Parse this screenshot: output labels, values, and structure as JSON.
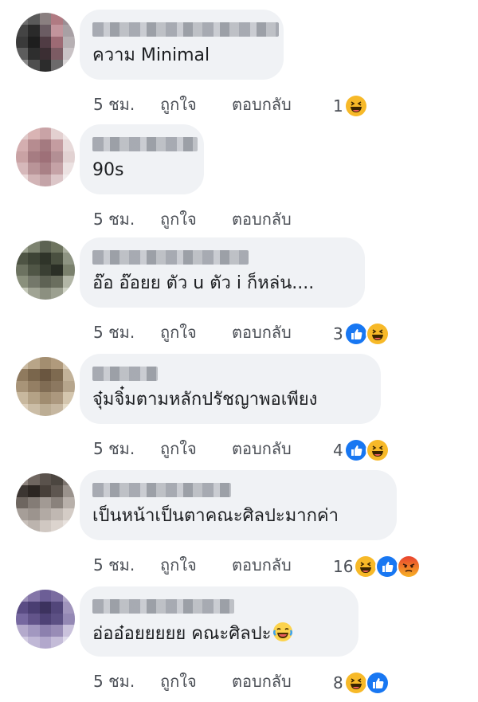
{
  "comments": [
    {
      "text": "ความ Minimal",
      "time": "5 ชม.",
      "like": "ถูกใจ",
      "reply": "ตอบกลับ",
      "reaction_count": "1",
      "reactions": [
        "haha-icon"
      ],
      "avatar_colors": [
        "#6f6f6f",
        "#5a5a5a",
        "#8a7f80",
        "#b07a82",
        "#9b8e94",
        "#444",
        "#2a2a2a",
        "#6b5c63",
        "#c2949c",
        "#a8a0a4",
        "#3a3a3a",
        "#1e1e1e",
        "#503c44",
        "#9d6a74",
        "#b7b0b3",
        "#5d5d5d",
        "#2e2e2e",
        "#3b2e33",
        "#7c5b63",
        "#c9c2c5",
        "#8a8a8a",
        "#4e4e4e",
        "#2c2c2c",
        "#6c6a6b",
        "#d8d5d6"
      ]
    },
    {
      "text": "90s",
      "time": "5 ชม.",
      "like": "ถูกใจ",
      "reply": "ตอบกลับ",
      "reaction_count": "",
      "reactions": [],
      "avatar_colors": [
        "#e0c9c9",
        "#d9b4b4",
        "#c9a3a6",
        "#e3d0d0",
        "#f0e6e6",
        "#d4aeb0",
        "#b68c90",
        "#a47a80",
        "#c49ca0",
        "#e8dada",
        "#c9a2a4",
        "#a67c82",
        "#9e7078",
        "#b38f94",
        "#e2d2d2",
        "#d6b8ba",
        "#b99498",
        "#a98086",
        "#c5a2a6",
        "#ece2e2",
        "#eadada",
        "#d2b4b6",
        "#c4a4a8",
        "#dcc6c8",
        "#f2ecec"
      ]
    },
    {
      "text": "อ๊อ อ๊อยย ตัว u ตัว i ก็หล่น....",
      "time": "5 ชม.",
      "like": "ถูกใจ",
      "reply": "ตอบกลับ",
      "reaction_count": "3",
      "reactions": [
        "like-icon",
        "haha-icon"
      ],
      "avatar_colors": [
        "#9aa08e",
        "#7d8370",
        "#5c6252",
        "#6e745f",
        "#a8ad9c",
        "#4e5444",
        "#3e4436",
        "#2f3429",
        "#4a5040",
        "#8e9482",
        "#6c7260",
        "#505646",
        "#3a3f33",
        "#2b2f26",
        "#7a806c",
        "#8a907c",
        "#74786a",
        "#5e6254",
        "#6a6e5e",
        "#b2b6a6",
        "#c4c8b8",
        "#a0a494",
        "#8c9080",
        "#9ca090",
        "#d0d4c6"
      ]
    },
    {
      "text": "จุ๋มจิ๋มตามหลักปรัชญาพอเพียง",
      "time": "5 ชม.",
      "like": "ถูกใจ",
      "reply": "ตอบกลับ",
      "reaction_count": "4",
      "reactions": [
        "like-icon",
        "haha-icon"
      ],
      "avatar_colors": [
        "#c9b9a0",
        "#b8a588",
        "#a38e70",
        "#b09a7c",
        "#d6c8b2",
        "#8f7a5e",
        "#7a664c",
        "#6a5640",
        "#7e6a50",
        "#c2b299",
        "#a89478",
        "#947f64",
        "#806c54",
        "#8c7860",
        "#b6a58c",
        "#c8b89e",
        "#b4a286",
        "#a08c70",
        "#ac987e",
        "#d4c6ae",
        "#ddd0bc",
        "#cbbda6",
        "#bcad94",
        "#c6b7a0",
        "#e6dcc8"
      ]
    },
    {
      "text": "เป็นหน้าเป็นตาคณะศิลปะมากค่า",
      "time": "5 ชม.",
      "like": "ถูกใจ",
      "reply": "ตอบกลับ",
      "reaction_count": "16",
      "reactions": [
        "haha-icon",
        "like-icon",
        "angry-icon"
      ],
      "avatar_colors": [
        "#8f8680",
        "#6f6660",
        "#5a524c",
        "#4c4640",
        "#7c746e",
        "#3c3632",
        "#2c2622",
        "#48403a",
        "#5e5650",
        "#9a928c",
        "#6e6660",
        "#847c76",
        "#a29a94",
        "#8a827c",
        "#b8b0aa",
        "#a69e98",
        "#9c948e",
        "#b2aaa4",
        "#c0b8b2",
        "#d4ccc6",
        "#c8c0ba",
        "#bcb4ae",
        "#d0c8c2",
        "#dcd4ce",
        "#e8e2de"
      ]
    },
    {
      "text": "อ่ออ๋อยยยยย คณะศิลปะ",
      "time": "5 ชม.",
      "like": "ถูกใจ",
      "reply": "ตอบกลับ",
      "reaction_count": "8",
      "reactions": [
        "haha-icon",
        "like-icon"
      ],
      "inline_emoji": "crying-laughing-icon",
      "avatar_colors": [
        "#9b8fb8",
        "#8475a8",
        "#6c5e96",
        "#7a6ca0",
        "#b0a6c8",
        "#5a4c84",
        "#4a3e72",
        "#3c325e",
        "#52467a",
        "#a094bc",
        "#7668a0",
        "#62548a",
        "#4e4276",
        "#5c5084",
        "#9488b4",
        "#b4aacc",
        "#a298c0",
        "#8c80ae",
        "#988cb6",
        "#cac2dc",
        "#d2cce2",
        "#c0b8d6",
        "#b2a8cc",
        "#c4bcd8",
        "#e0dcec"
      ]
    }
  ]
}
